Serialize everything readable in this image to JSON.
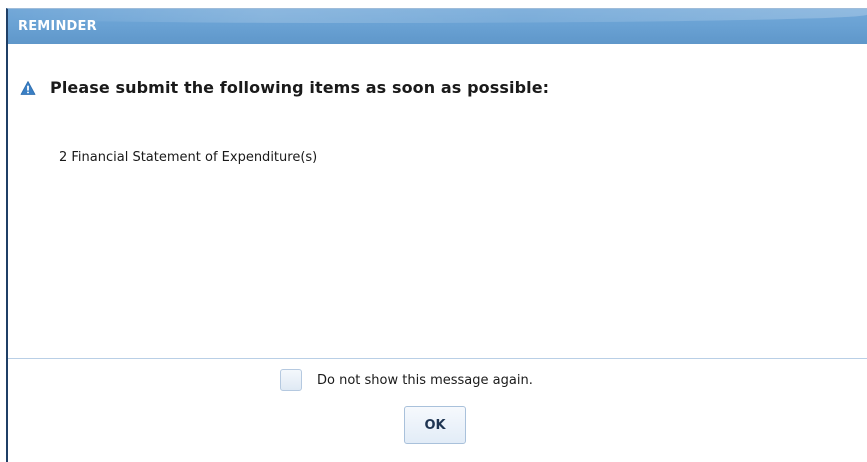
{
  "dialog": {
    "title": "REMINDER",
    "heading": "Please submit the following items as soon as possible:",
    "items": [
      "2 Financial Statement of Expenditure(s)"
    ],
    "checkbox_label": "Do not show this message again.",
    "checkbox_checked": false,
    "ok_label": "OK",
    "icon": "warning-triangle-icon"
  },
  "colors": {
    "titlebar": "#6aa2d4",
    "accent_icon": "#3a7fc4",
    "border": "#1f3f66"
  }
}
